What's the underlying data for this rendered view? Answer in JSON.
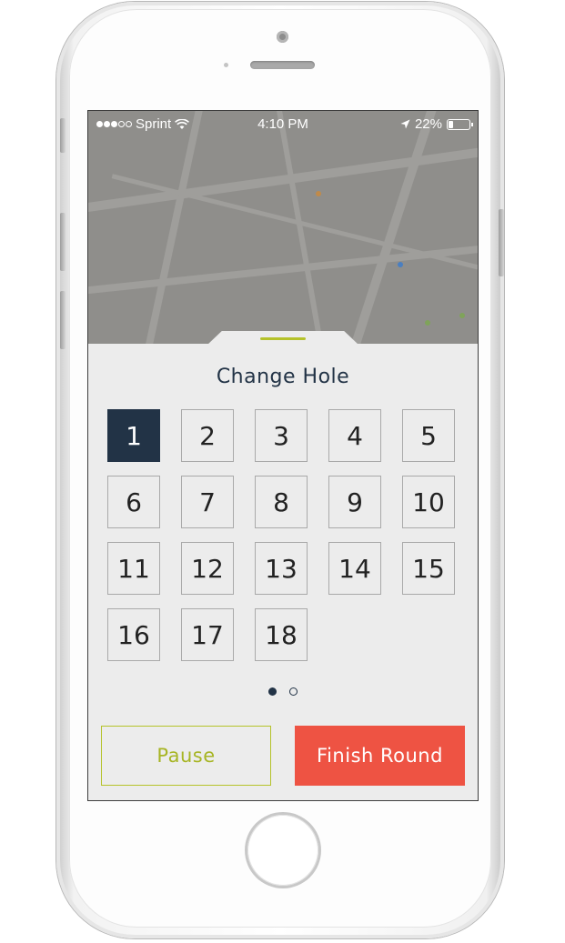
{
  "status_bar": {
    "carrier": "Sprint",
    "time": "4:10 PM",
    "battery": "22%",
    "battery_level": 0.22,
    "signal_bars_filled": 3,
    "signal_bars_total": 5
  },
  "sheet": {
    "title": "Change Hole",
    "selected_hole": "1",
    "holes": [
      "1",
      "2",
      "3",
      "4",
      "5",
      "6",
      "7",
      "8",
      "9",
      "10",
      "11",
      "12",
      "13",
      "14",
      "15",
      "16",
      "17",
      "18"
    ],
    "page_indicator": {
      "pages": 2,
      "current": 1
    }
  },
  "actions": {
    "pause_label": "Pause",
    "finish_label": "Finish Round"
  },
  "colors": {
    "navy": "#223346",
    "accent_green": "#b5c22a",
    "finish_red": "#ee5343",
    "sheet_bg": "#ececec"
  }
}
